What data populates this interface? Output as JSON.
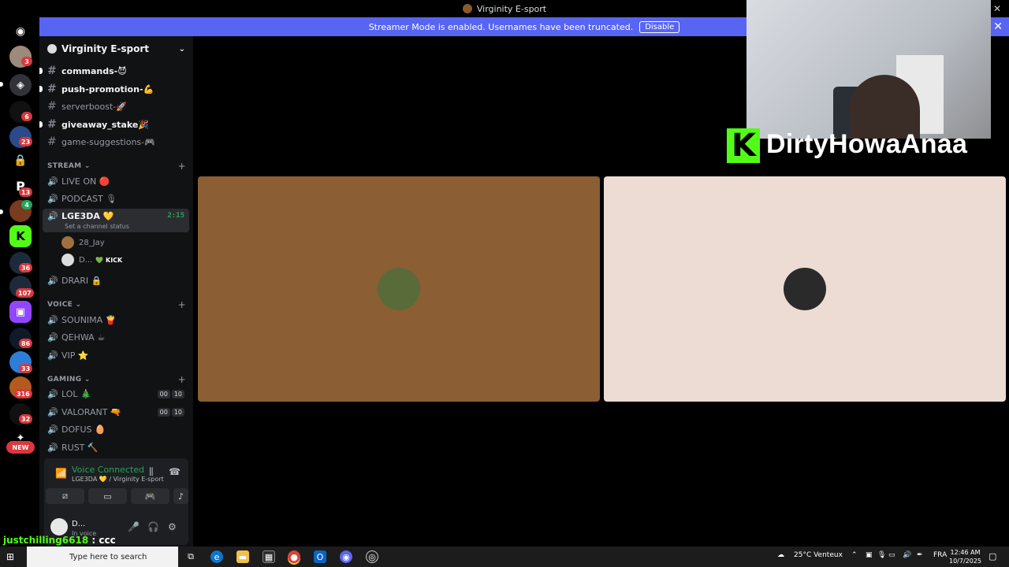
{
  "window": {
    "title": "Virginity E-sport"
  },
  "banner": {
    "text": "Streamer Mode is enabled. Usernames have been truncated.",
    "button": "Disable"
  },
  "servers": [
    {
      "badge": "3"
    },
    {
      "badge": ""
    },
    {
      "badge": "6"
    },
    {
      "badge": "23"
    },
    {
      "badge": ""
    },
    {
      "badge": "13"
    },
    {
      "badge": "4"
    },
    {
      "badge": ""
    },
    {
      "badge": "36"
    },
    {
      "badge": "107"
    },
    {
      "badge": ""
    },
    {
      "badge": "86"
    },
    {
      "badge": "33"
    },
    {
      "badge": "316"
    },
    {
      "badge": "32"
    }
  ],
  "new_badge": "NEW",
  "guild": {
    "name": "Virginity E-sport"
  },
  "channels": {
    "text": [
      {
        "name": "commands-",
        "emoji": "😈",
        "bold": true
      },
      {
        "name": "push-promotion-",
        "emoji": "💪",
        "bold": true
      },
      {
        "name": "serverboost-",
        "emoji": "🚀",
        "bold": false
      },
      {
        "name": "giveaway_stake",
        "emoji": "🎉",
        "bold": true
      },
      {
        "name": "game-suggestions-",
        "emoji": "🎮",
        "bold": false
      }
    ],
    "stream_category": "STREAM",
    "stream": [
      {
        "name": "LIVE ON",
        "emoji": "🔴"
      },
      {
        "name": "PODCAST",
        "emoji": "🎙"
      },
      {
        "name": "LGE3DA",
        "emoji": "💛",
        "timer": "2:15",
        "status": "Set a channel status"
      },
      {
        "name": "DRARI",
        "emoji": "🔒"
      }
    ],
    "voice_users": [
      {
        "name": "28_Jay",
        "extra": ""
      },
      {
        "name": "D...",
        "extra": "💚 KICK"
      }
    ],
    "voice_category": "VOICE",
    "voice": [
      {
        "name": "SOUNIMA",
        "emoji": "🍟"
      },
      {
        "name": "QEHWA",
        "emoji": "☕"
      },
      {
        "name": "VIP",
        "emoji": "⭐"
      }
    ],
    "gaming_category": "GAMING",
    "gaming": [
      {
        "name": "LOL",
        "emoji": "🎄",
        "count1": "00",
        "count2": "10"
      },
      {
        "name": "VALORANT",
        "emoji": "🔫",
        "count1": "00",
        "count2": "10"
      },
      {
        "name": "DOFUS",
        "emoji": "🥚"
      },
      {
        "name": "RUST",
        "emoji": "🔨"
      }
    ]
  },
  "voice_panel": {
    "title": "Voice Connected",
    "subtitle": "LGE3DA 💛 / Virginity E-sport"
  },
  "user": {
    "name": "D...",
    "status": "In voice"
  },
  "overlay": {
    "kick_name": "DirtyHowaAnaa",
    "chat_user": "justchilling6618",
    "chat_message": ": ccc"
  },
  "taskbar": {
    "search_placeholder": "Type here to search",
    "weather": "25°C  Venteux",
    "lang": "FRA",
    "time": "12:46 AM",
    "date": "10/7/2025"
  },
  "colors": {
    "accent": "#5865f2",
    "kick_green": "#53fc18",
    "tile_left": "#8b5e34",
    "tile_right": "#ecdcd3"
  }
}
